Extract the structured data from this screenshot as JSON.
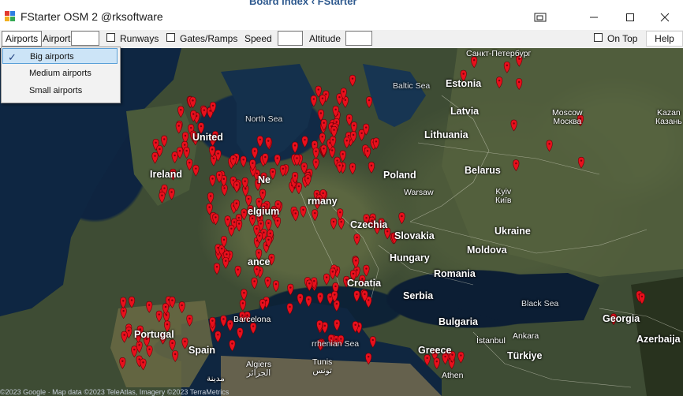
{
  "window": {
    "title": "FStarter OSM 2 @rksoftware",
    "background_tab_text": "Board index  ‹  FStarter"
  },
  "toolbar": {
    "airports_menu": "Airports",
    "airport_label": "Airport",
    "airport_value": "",
    "runways_label": "Runways",
    "runways_checked": false,
    "gates_label": "Gates/Ramps",
    "gates_checked": false,
    "speed_label": "Speed",
    "speed_value": "",
    "altitude_label": "Altitude",
    "altitude_value": "",
    "ontop_label": "On Top",
    "ontop_checked": false,
    "help_label": "Help"
  },
  "dropdown": {
    "items": [
      {
        "label": "Big airports",
        "checked": true
      },
      {
        "label": "Medium airports",
        "checked": false
      },
      {
        "label": "Small airports",
        "checked": false
      }
    ]
  },
  "map": {
    "countries": {
      "ireland": "Ireland",
      "united": "United",
      "poland": "Poland",
      "belarus": "Belarus",
      "lithuania": "Lithuania",
      "latvia": "Latvia",
      "estonia": "Estonia",
      "ukraine": "Ukraine",
      "moldova": "Moldova",
      "romania": "Romania",
      "serbia": "Serbia",
      "bulgaria": "Bulgaria",
      "greece": "Greece",
      "turkiye": "Türkiye",
      "hungary": "Hungary",
      "slovakia": "Slovakia",
      "czechia": "Czechia",
      "croatia": "Croatia",
      "germany": "rmany",
      "belgium": "elgium",
      "netherlands": "Ne",
      "france": "ance",
      "portugal": "Portugal",
      "spain": "Spain",
      "georgia": "Georgia",
      "azerbaijan": "Azerbaija"
    },
    "seas": {
      "north_sea": "North Sea",
      "baltic_sea": "Baltic Sea",
      "black_sea": "Black Sea",
      "tyrrhenian_sea": "rrhenian Sea"
    },
    "cities": {
      "st_petersburg": "Санкт-Петербург",
      "moscow": "Moscow\nМосква",
      "kazan": "Kazan\nКазань",
      "warsaw": "Warsaw",
      "kyiv": "Kyiv\nКиїв",
      "istanbul": "İstanbul",
      "ankara": "Ankara",
      "athens": "Athen",
      "algiers": "Algiers\nالجزائر",
      "tunis": "Tunis\nتونس",
      "medina": "مدينة",
      "barcelona": "Barcelona"
    },
    "attribution": "©2023 Google · Map data ©2023 TeleAtlas, Imagery ©2023 TerraMetrics",
    "pin_color": "#e8101c"
  }
}
